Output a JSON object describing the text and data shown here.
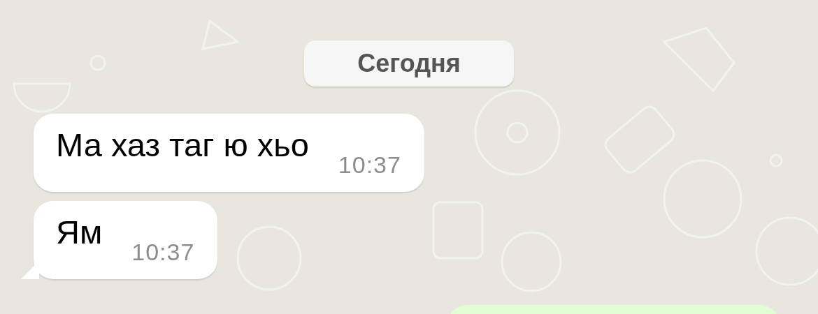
{
  "date_separator": {
    "label": "Сегодня"
  },
  "messages": [
    {
      "kind": "incoming",
      "text": "Ма хаз таг ю хьо",
      "time": "10:37",
      "tail": false
    },
    {
      "kind": "incoming",
      "text": "Ям",
      "time": "10:37",
      "tail": true
    },
    {
      "kind": "outgoing",
      "tail": false
    }
  ]
}
